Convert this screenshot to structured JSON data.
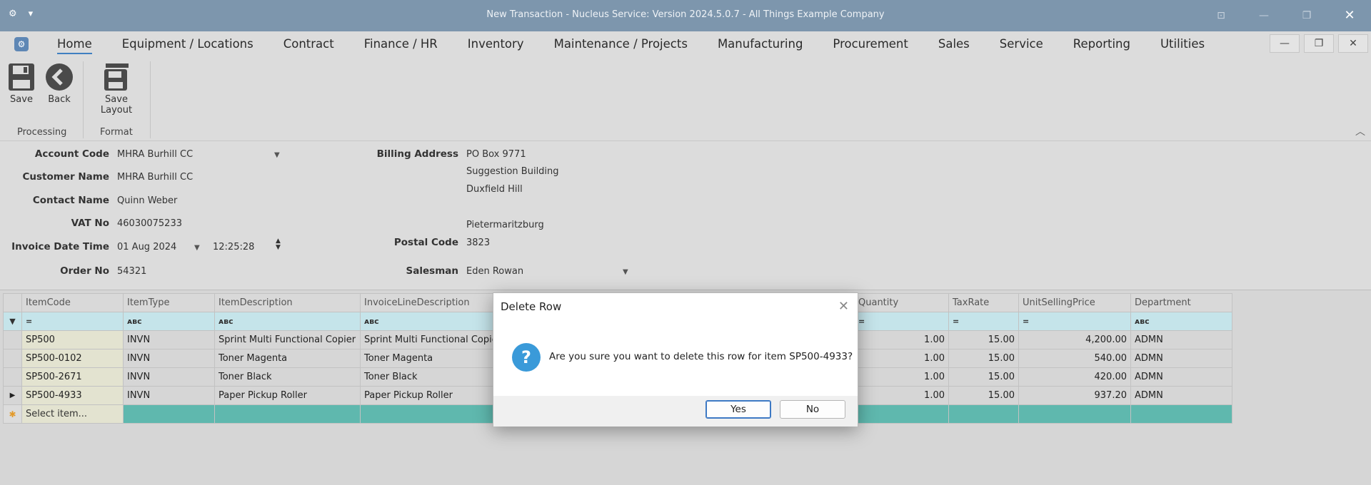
{
  "window": {
    "title": "New Transaction - Nucleus Service: Version 2024.5.0.7 - All Things Example Company"
  },
  "menu": {
    "items": [
      "Home",
      "Equipment / Locations",
      "Contract",
      "Finance / HR",
      "Inventory",
      "Maintenance / Projects",
      "Manufacturing",
      "Procurement",
      "Sales",
      "Service",
      "Reporting",
      "Utilities"
    ],
    "active": "Home"
  },
  "ribbon": {
    "save_label": "Save",
    "back_label": "Back",
    "save_layout_label": "Save Layout",
    "group_processing": "Processing",
    "group_format": "Format"
  },
  "form": {
    "account_code_label": "Account Code",
    "account_code": "MHRA Burhill CC",
    "customer_name_label": "Customer Name",
    "customer_name": "MHRA Burhill CC",
    "contact_name_label": "Contact Name",
    "contact_name": "Quinn Weber",
    "vat_no_label": "VAT No",
    "vat_no": "46030075233",
    "invoice_datetime_label": "Invoice Date Time",
    "invoice_date": "01 Aug 2024",
    "invoice_time": "12:25:28",
    "order_no_label": "Order No",
    "order_no": "54321",
    "billing_address_label": "Billing Address",
    "billing_address_1": "PO Box 9771",
    "billing_address_2": "Suggestion Building",
    "billing_address_3": "Duxfield Hill",
    "billing_address_4": "Pietermaritzburg",
    "postal_code_label": "Postal Code",
    "postal_code": "3823",
    "salesman_label": "Salesman",
    "salesman": "Eden Rowan"
  },
  "grid": {
    "headers": [
      "ItemCode",
      "ItemType",
      "ItemDescription",
      "InvoiceLineDescription",
      "Quantity",
      "TaxRate",
      "UnitSellingPrice",
      "Department"
    ],
    "filter_eq": "=",
    "filter_text": "ᴀʙc",
    "rows": [
      [
        "SP500",
        "INVN",
        "Sprint Multi Functional Copier",
        "Sprint Multi Functional Copier",
        "1.00",
        "15.00",
        "4,200.00",
        "ADMN"
      ],
      [
        "SP500-0102",
        "INVN",
        "Toner Magenta",
        "Toner Magenta",
        "1.00",
        "15.00",
        "540.00",
        "ADMN"
      ],
      [
        "SP500-2671",
        "INVN",
        "Toner Black",
        "Toner Black",
        "1.00",
        "15.00",
        "420.00",
        "ADMN"
      ],
      [
        "SP500-4933",
        "INVN",
        "Paper Pickup Roller",
        "Paper Pickup Roller",
        "1.00",
        "15.00",
        "937.20",
        "ADMN"
      ]
    ],
    "new_row_placeholder": "Select item..."
  },
  "dialog": {
    "title": "Delete Row",
    "message": "Are you sure you want to delete this row for item SP500-4933?",
    "yes_label": "Yes",
    "no_label": "No"
  },
  "colors": {
    "titlebar": "#7d96ad",
    "accent": "#3f7fc1",
    "new_row": "#5fb8ae",
    "question_icon": "#3a9ad9"
  }
}
